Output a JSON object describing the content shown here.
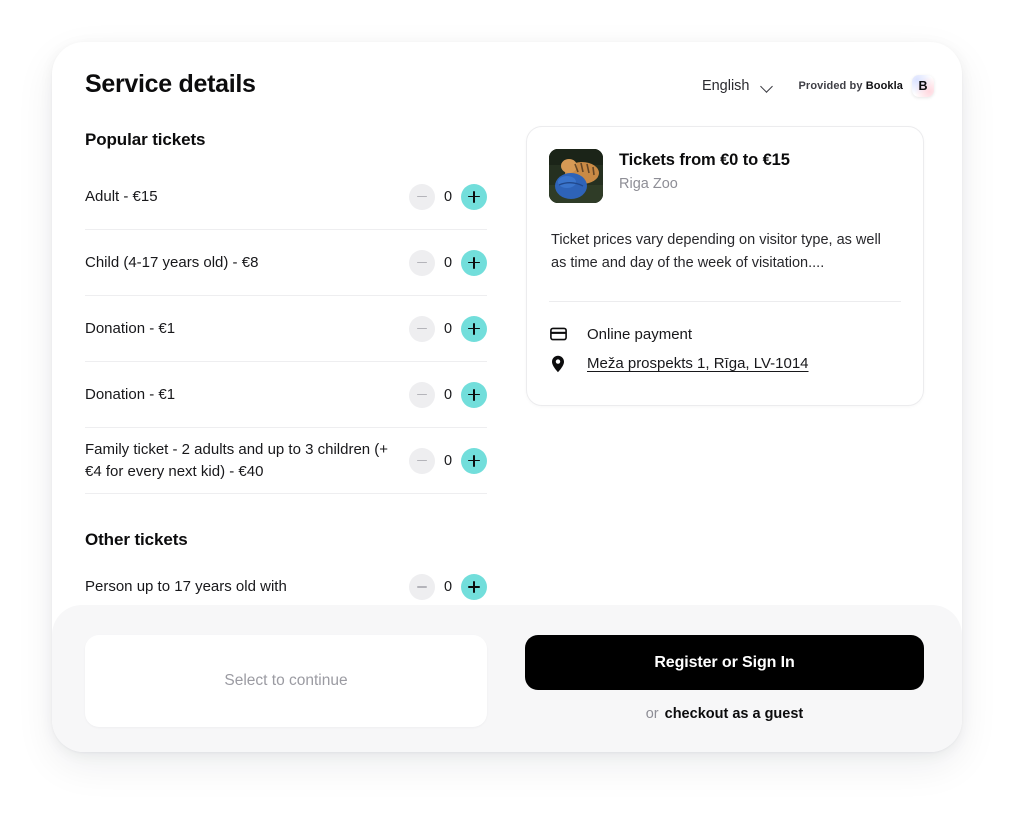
{
  "header": {
    "title": "Service details",
    "language": "English",
    "language_chevron_icon": "chevron-down-icon",
    "provided_by_prefix": "Provided by",
    "provided_by_brand": "Bookla",
    "brand_badge_letter": "B"
  },
  "tickets": {
    "popular_title": "Popular tickets",
    "other_title": "Other tickets",
    "popular_items": [
      {
        "label": "Adult - €15",
        "qty": "0",
        "minus_icon": "minus-icon",
        "plus_icon": "plus-icon"
      },
      {
        "label": "Child (4-17 years old) - €8",
        "qty": "0",
        "minus_icon": "minus-icon",
        "plus_icon": "plus-icon"
      },
      {
        "label": "Donation -  €1",
        "qty": "0",
        "minus_icon": "minus-icon",
        "plus_icon": "plus-icon"
      },
      {
        "label": "Donation - €1",
        "qty": "0",
        "minus_icon": "minus-icon",
        "plus_icon": "plus-icon"
      },
      {
        "label": "Family ticket - 2 adults and up to 3 children (+ €4 for every next kid) - €40",
        "qty": "0",
        "minus_icon": "minus-icon",
        "plus_icon": "plus-icon"
      }
    ],
    "other_items": [
      {
        "label": "Person up to 17 years old with",
        "qty": "0",
        "minus_icon": "minus-icon",
        "plus_icon": "plus-icon"
      }
    ]
  },
  "summary": {
    "thumbnail_icon": "tiger-photo-thumbnail",
    "title": "Tickets from €0 to €15",
    "subtitle": "Riga Zoo",
    "description": "Ticket prices vary depending on visitor type, as well as time and day of the week of visitation....",
    "payment_icon": "credit-card-icon",
    "payment_label": "Online payment",
    "location_icon": "map-pin-icon",
    "location_label": "Meža prospekts 1, Rīga, LV-1014"
  },
  "footer": {
    "select_placeholder": "Select to continue",
    "primary_button": "Register or Sign In",
    "or_text": "or",
    "guest_link": "checkout as a guest"
  },
  "colors": {
    "accent": "#72DEDB",
    "primary_button": "#000000",
    "footer_bg": "#F7F7F8",
    "muted_text": "#8E8E96",
    "divider": "#ECECEE"
  }
}
